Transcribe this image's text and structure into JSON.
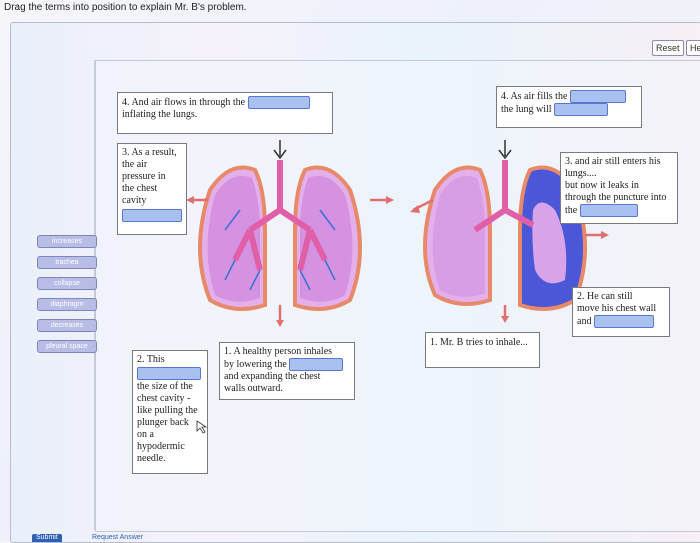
{
  "instruction": "Drag the terms into position to explain Mr. B's problem.",
  "buttons": {
    "reset": "Reset",
    "help": "He"
  },
  "terms": [
    "increases",
    "trachea",
    "collapse",
    "diaphragm",
    "decreases",
    "pleural space"
  ],
  "boxes": {
    "box_4_left": "4. And air flows in through the",
    "box_4_left_line2": "inflating the lungs.",
    "box_4_right_line1": "4. As air fills the",
    "box_4_right_line2": "the lung will",
    "box_3_left_lines": [
      "3. As a result,",
      "the air",
      "pressure in",
      "the chest",
      "cavity"
    ],
    "box_3_right_lines": [
      "3. and air still enters his",
      "lungs....",
      "but now it leaks in",
      "through the puncture into",
      "the"
    ],
    "box_2_left_lines": [
      "2. This",
      "the size of the",
      "chest cavity -",
      "like pulling the",
      "plunger back",
      "on a",
      "hypodermic",
      "needle."
    ],
    "box_1_mid_line1": "1. A healthy person inhales",
    "box_1_mid_line2": "by lowering the",
    "box_1_mid_line3": "and expanding the chest",
    "box_1_mid_line4": "walls outward.",
    "box_1_right": "1. Mr. B tries to inhale...",
    "box_2_right_lines": [
      "2. He can still",
      "move his chest wall",
      "and"
    ]
  },
  "footer": {
    "submit": "Submit",
    "request": "Request Answer"
  },
  "colors": {
    "lung_fill": "#d98ee0",
    "lung_outline": "#e88a6a",
    "airway": "#e05fa8",
    "vessel": "#3a6fd8",
    "blank_fill": "#a8c1f0",
    "term_fill": "#b8bde6",
    "arrow": "#e07070"
  }
}
